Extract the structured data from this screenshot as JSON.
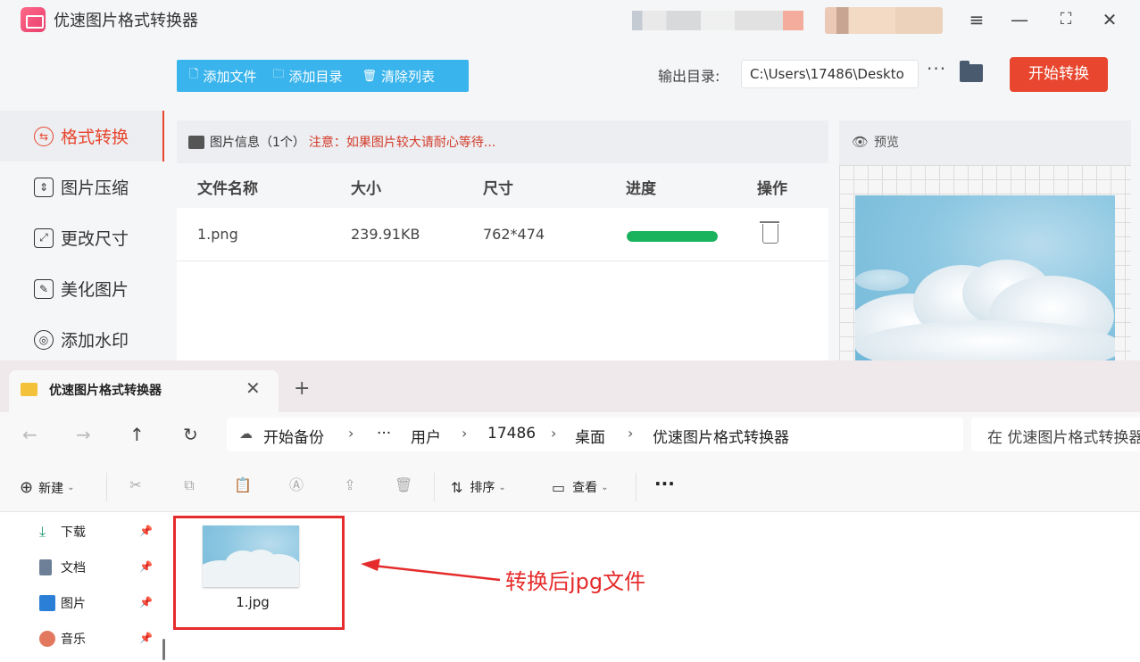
{
  "app": {
    "title": "优速图片格式转换器",
    "accent_color": "#e8462e",
    "menu_icon": "≡",
    "minimize_icon": "—",
    "maximize_icon": "⛶",
    "close_icon": "✕"
  },
  "sidebar": {
    "items": [
      {
        "label": "格式转换",
        "icon": "convert-icon",
        "active": true
      },
      {
        "label": "图片压缩",
        "icon": "compress-icon"
      },
      {
        "label": "更改尺寸",
        "icon": "resize-icon"
      },
      {
        "label": "美化图片",
        "icon": "beautify-icon"
      },
      {
        "label": "添加水印",
        "icon": "watermark-icon"
      }
    ]
  },
  "toolbar": {
    "add_file": "添加文件",
    "add_folder": "添加目录",
    "clear_list": "清除列表",
    "output_label": "输出目录:",
    "output_path": "C:\\Users\\17486\\Deskto",
    "more": "···",
    "start": "开始转换"
  },
  "info": {
    "title": "图片信息（1个）",
    "notice": "注意：如果图片较大请耐心等待..."
  },
  "table": {
    "headers": [
      "文件名称",
      "大小",
      "尺寸",
      "进度",
      "操作"
    ],
    "rows": [
      {
        "name": "1.png",
        "size": "239.91KB",
        "dimensions": "762*474",
        "progress": 1.0
      }
    ],
    "progress_color": "#19b25d"
  },
  "preview": {
    "label": "预览"
  },
  "explorer": {
    "tab_title": "优速图片格式转换器",
    "tab_close": "✕",
    "new_tab": "+",
    "back": "←",
    "forward": "→",
    "up": "↑",
    "refresh": "↻",
    "breadcrumb": [
      "开始备份",
      "···",
      "用户",
      "17486",
      "桌面",
      "优速图片格式转换器"
    ],
    "search_placeholder": "在 优速图片格式转换器",
    "commands": {
      "new": "新建",
      "sort": "排序",
      "view": "查看",
      "more": "···"
    },
    "side_items": [
      {
        "label": "下载",
        "icon": "download-icon"
      },
      {
        "label": "文档",
        "icon": "document-icon"
      },
      {
        "label": "图片",
        "icon": "pictures-icon"
      },
      {
        "label": "音乐",
        "icon": "music-icon"
      }
    ],
    "file": {
      "name": "1.jpg"
    }
  },
  "annotation": {
    "text": "转换后jpg文件",
    "color": "#e52b2b"
  }
}
